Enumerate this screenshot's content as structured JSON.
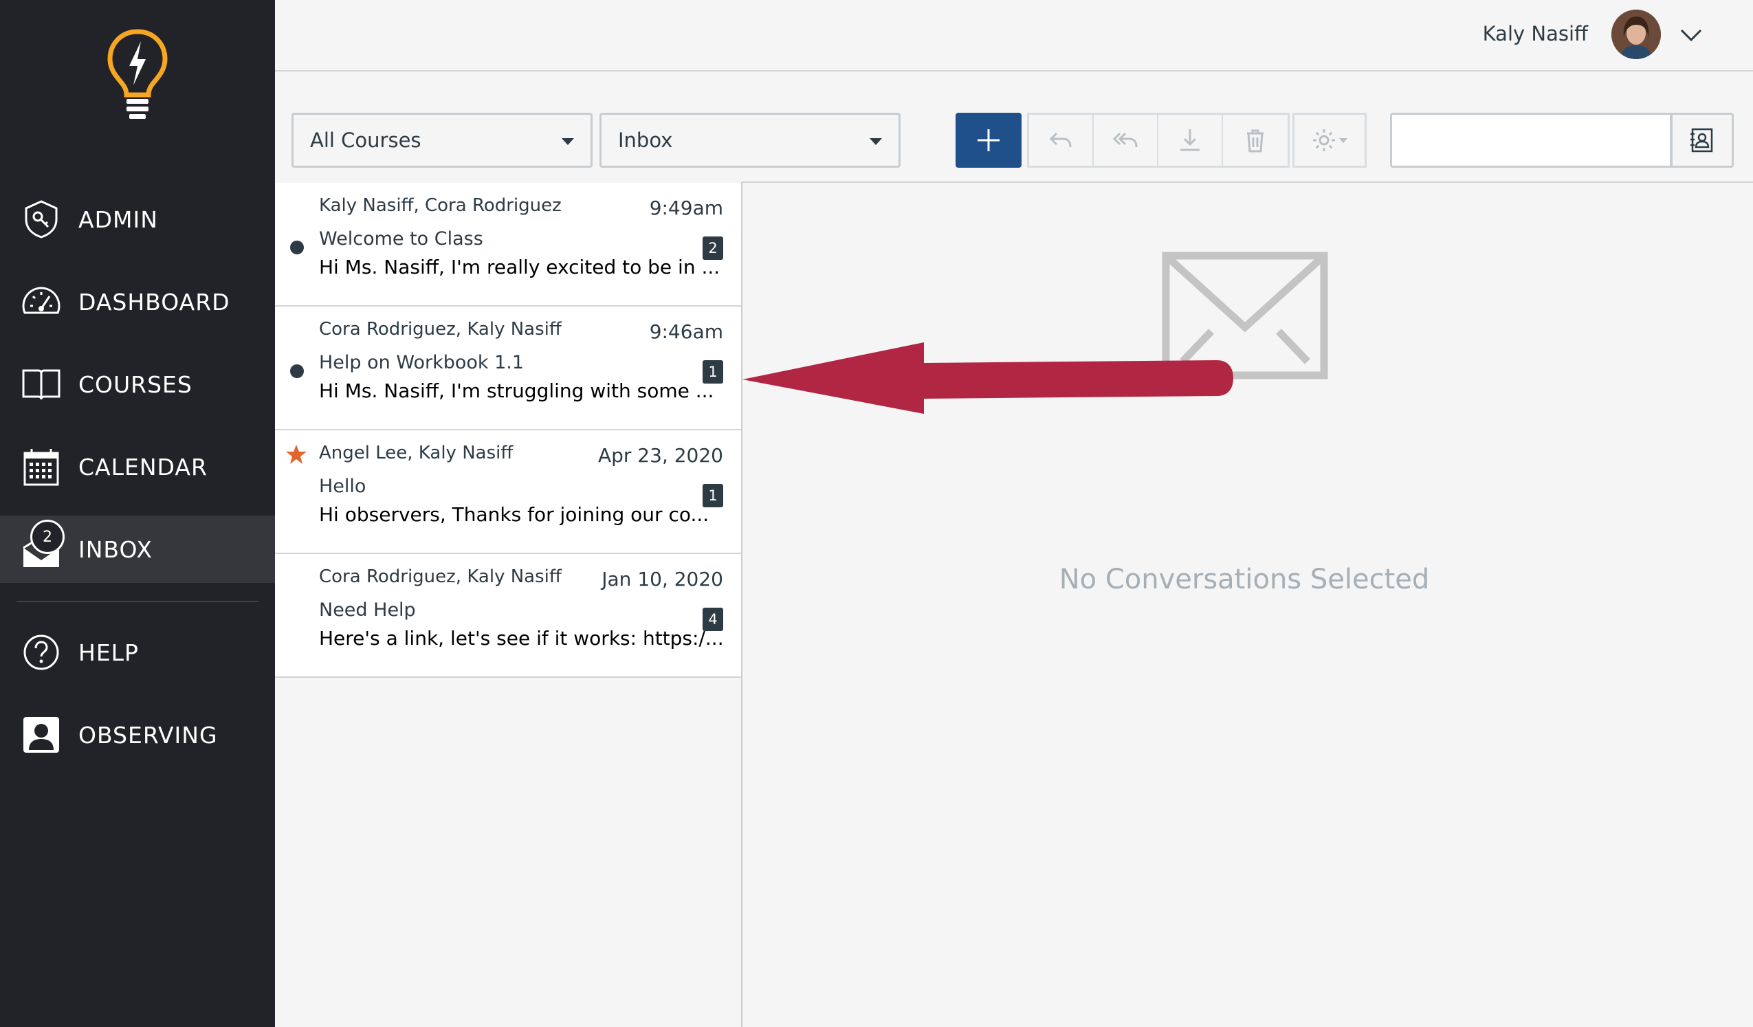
{
  "sidebar": {
    "items": [
      {
        "label": "ADMIN",
        "icon": "shield-key-icon"
      },
      {
        "label": "DASHBOARD",
        "icon": "speedometer-icon"
      },
      {
        "label": "COURSES",
        "icon": "book-icon"
      },
      {
        "label": "CALENDAR",
        "icon": "calendar-icon"
      },
      {
        "label": "INBOX",
        "icon": "inbox-icon",
        "badge": "2"
      },
      {
        "label": "HELP",
        "icon": "help-icon"
      },
      {
        "label": "OBSERVING",
        "icon": "observing-icon"
      }
    ]
  },
  "header": {
    "user_name": "Kaly Nasiff"
  },
  "toolbar": {
    "course_filter": "All Courses",
    "mailbox_filter": "Inbox"
  },
  "conversations": [
    {
      "participants": "Kaly Nasiff, Cora Rodriguez",
      "date": "9:49am",
      "subject": "Welcome to Class",
      "preview": "Hi Ms. Nasiff, I'm really excited to be in ...",
      "count": "2",
      "unread": true,
      "starred": false
    },
    {
      "participants": "Cora Rodriguez, Kaly Nasiff",
      "date": "9:46am",
      "subject": "Help on Workbook 1.1",
      "preview": "Hi Ms. Nasiff, I'm struggling with some ...",
      "count": "1",
      "unread": true,
      "starred": false
    },
    {
      "participants": "Angel Lee, Kaly Nasiff",
      "date": "Apr 23, 2020",
      "subject": "Hello",
      "preview": "Hi observers, Thanks for joining our co...",
      "count": "1",
      "unread": false,
      "starred": true
    },
    {
      "participants": "Cora Rodriguez, Kaly Nasiff",
      "date": "Jan 10, 2020",
      "subject": "Need Help",
      "preview": "Here's a link, let's see if it works: https:/...",
      "count": "4",
      "unread": false,
      "starred": false
    }
  ],
  "detail": {
    "empty_message": "No Conversations Selected"
  },
  "colors": {
    "sidebar_bg": "#222328",
    "compose_button": "#20508a",
    "star": "#e0652b",
    "annotation_arrow": "#b12642"
  }
}
